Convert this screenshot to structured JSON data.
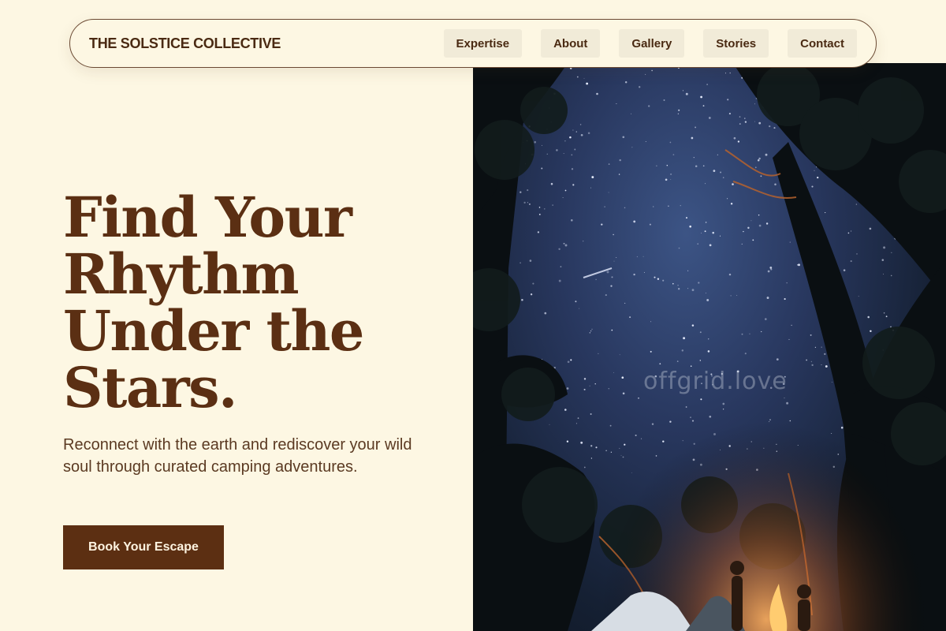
{
  "brand": {
    "name": "THE SOLSTICE COLLECTIVE"
  },
  "nav": {
    "links": [
      "Expertise",
      "About",
      "Gallery",
      "Stories",
      "Contact"
    ]
  },
  "hero": {
    "headline_lines": [
      "Find Your",
      "Rhythm",
      "Under the",
      "Stars."
    ],
    "subtext": "Reconnect with the earth and rediscover your wild soul through curated camping adventures.",
    "cta_label": "Book Your Escape",
    "image_watermark": "offgrid.love"
  },
  "colors": {
    "background": "#fdf7e3",
    "primary": "#5c2f12",
    "nav_pill": "#f1ebd8",
    "text_muted": "#5b3a22"
  }
}
